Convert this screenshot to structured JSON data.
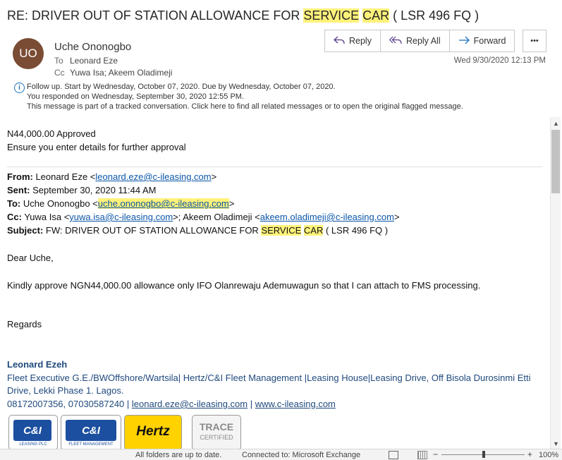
{
  "email": {
    "subject_pre": "RE: DRIVER OUT OF STATION ALLOWANCE FOR ",
    "subject_hl1": "SERVICE",
    "subject_hl2": "CAR",
    "subject_post": " ( LSR 496 FQ )",
    "sender_initials": "UO",
    "sender_name": "Uche Ononogbo",
    "to_label": "To",
    "to_value": "Leonard Eze",
    "cc_label": "Cc",
    "cc_value": "Yuwa Isa; Akeem Oladimeji",
    "date": "Wed 9/30/2020 12:13 PM"
  },
  "actions": {
    "reply": "Reply",
    "reply_all": "Reply All",
    "forward": "Forward",
    "more": "•••"
  },
  "followup": {
    "line1": "Follow up.  Start by Wednesday, October 07, 2020.  Due by Wednesday, October 07, 2020.",
    "line2": "You responded  on Wednesday, September 30, 2020 12:55 PM.",
    "line3": "This message is part of a tracked conversation. Click here to find all related messages or to open the original flagged message."
  },
  "body": {
    "line1": "N44,000.00 Approved",
    "line2": "Ensure you enter details for further approval",
    "quoted": {
      "from_label": "From:",
      "from_name": " Leonard Eze <",
      "from_email": "leonard.eze@c-ileasing.com",
      "from_end": ">",
      "sent_label": "Sent:",
      "sent_value": " September 30, 2020 11:44 AM",
      "to_label": "To:",
      "to_name": " Uche Ononogbo <",
      "to_email": "uche.ononogbo@c-ileasing.com",
      "to_end": ">",
      "cc_label": "Cc:",
      "cc_name1": " Yuwa Isa <",
      "cc_email1": "yuwa.isa@c-ileasing.com",
      "cc_mid": ">; Akeem Oladimeji <",
      "cc_email2": "akeem.oladimeji@c-ileasing.com",
      "cc_end": ">",
      "subject_label": "Subject:",
      "subject_pre": " FW: DRIVER OUT OF STATION ALLOWANCE FOR ",
      "subject_hl1": "SERVICE",
      "subject_hl2": "CAR",
      "subject_post": " ( LSR 496 FQ )"
    },
    "greeting": "Dear Uche,",
    "message": "Kindly approve NGN44,000.00 allowance only IFO Olanrewaju Ademuwagun so that I can attach to FMS processing.",
    "regards": "Regards"
  },
  "signature": {
    "name": "Leonard Ezeh",
    "title_line1": "Fleet Executive G.E./BWOffshore/Wartsila| Hertz/C&I Fleet Management |Leasing House|Leasing Drive, Off Bisola Durosinmi Etti",
    "title_line2": "Drive, Lekki Phase 1. Lagos.",
    "phones": "08172007356, 07030587240 | ",
    "email": "leonard.eze@c-ileasing.com",
    "sep": " | ",
    "website": "www.c-ileasing.com",
    "logo1": "C&I",
    "logo1_sub": "LEASING PLC",
    "logo2": "C&I",
    "logo2_sub": "FLEET MANAGEMENT",
    "logo3": "Hertz",
    "logo4": "TRACE",
    "logo4_sub": "CERTIFIED"
  },
  "statusbar": {
    "left": "All folders are up to date.",
    "connection": "Connected to: Microsoft Exchange",
    "zoom": "100%"
  },
  "colors": {
    "highlight": "#fff27a",
    "link": "#0b56a8",
    "signature": "#1f497d",
    "avatar": "#7a4c34",
    "hertz": "#ffd200"
  }
}
